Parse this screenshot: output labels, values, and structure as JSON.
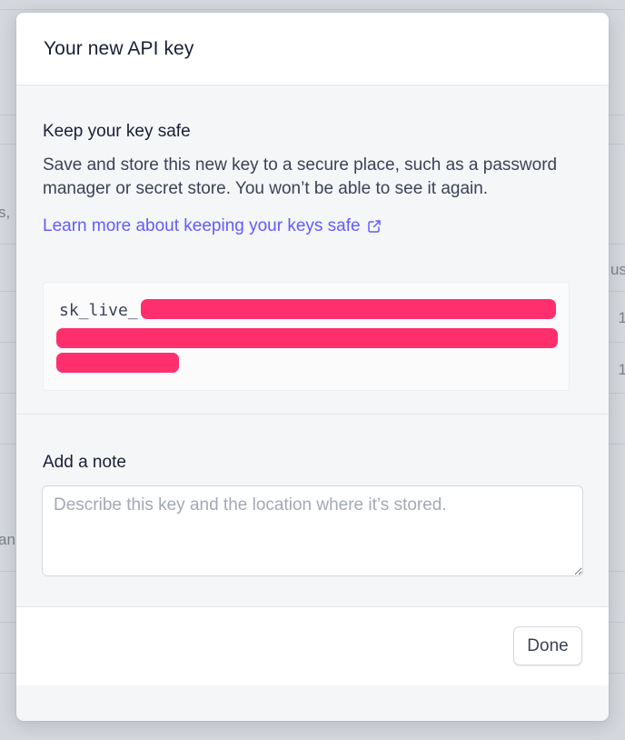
{
  "background": {
    "left_fragments": [
      "s,",
      "an"
    ],
    "right_fragments": [
      "us",
      "1",
      "1"
    ]
  },
  "modal": {
    "title": "Your new API key",
    "safe_section": {
      "heading": "Keep your key safe",
      "body": "Save and store this new key to a secure place, such as a password manager or secret store. You won’t be able to see it again.",
      "link_label": "Learn more about keeping your keys safe",
      "link_icon": "external-link-icon"
    },
    "key": {
      "prefix": "sk_live_",
      "redaction_color": "#ff2f6e"
    },
    "note": {
      "label": "Add a note",
      "placeholder": "Describe this key and the location where it’s stored.",
      "value": ""
    },
    "footer": {
      "done_label": "Done"
    }
  },
  "colors": {
    "accent": "#635bff",
    "redaction": "#ff2f6e",
    "backdrop": "#d4d7dc"
  }
}
